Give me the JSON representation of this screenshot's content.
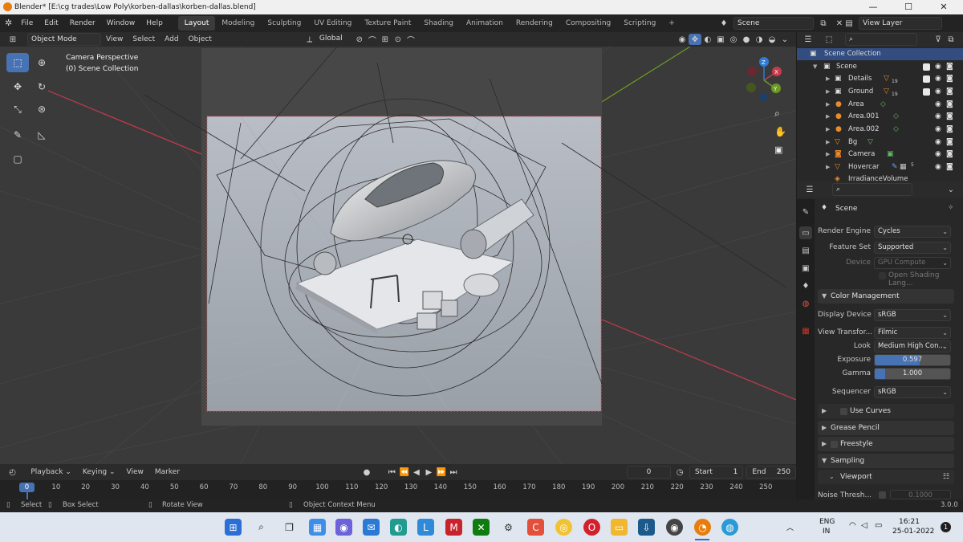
{
  "titlebar": {
    "title": "Blender* [E:\\cg trades\\Low Poly\\korben-dallas\\korben-dallas.blend]",
    "min": "—",
    "max": "☐",
    "close": "✕"
  },
  "menu": {
    "items": [
      "File",
      "Edit",
      "Render",
      "Window",
      "Help"
    ]
  },
  "workspaces": [
    {
      "label": "Layout",
      "active": true
    },
    {
      "label": "Modeling"
    },
    {
      "label": "Sculpting"
    },
    {
      "label": "UV Editing"
    },
    {
      "label": "Texture Paint"
    },
    {
      "label": "Shading"
    },
    {
      "label": "Animation"
    },
    {
      "label": "Rendering"
    },
    {
      "label": "Compositing"
    },
    {
      "label": "Scripting"
    },
    {
      "label": "+"
    }
  ],
  "scene_selector": {
    "value": "Scene"
  },
  "view_layer_selector": {
    "value": "View Layer"
  },
  "viewport_header": {
    "mode": "Object Mode",
    "menus": [
      "View",
      "Select",
      "Add",
      "Object"
    ],
    "transform_orientation": "Global"
  },
  "viewport": {
    "camera_label": "Camera Perspective",
    "collection_label": "(0) Scene Collection",
    "gizmo_axes": {
      "x": "X",
      "y": "Y",
      "z": "Z"
    },
    "colors": {
      "x_axis": "#c43b4d",
      "y_axis": "#6c9a21",
      "z_axis": "#2f7bd6",
      "background": "#3a3a3a"
    }
  },
  "outliner": {
    "rows": [
      {
        "name": "Scene Collection",
        "selected": true,
        "icon": "collection-icon"
      },
      {
        "name": "Scene",
        "icon": "collection-icon",
        "checkbox": true
      },
      {
        "name": "Details",
        "icon": "collection-icon",
        "checkbox": true,
        "badge": "19"
      },
      {
        "name": "Ground",
        "icon": "collection-icon",
        "checkbox": true,
        "badge": "19"
      },
      {
        "name": "Area",
        "icon": "light-icon"
      },
      {
        "name": "Area.001",
        "icon": "light-icon"
      },
      {
        "name": "Area.002",
        "icon": "light-icon"
      },
      {
        "name": "Bg",
        "icon": "mesh-icon"
      },
      {
        "name": "Camera",
        "icon": "camera-icon"
      },
      {
        "name": "Hovercar",
        "icon": "mesh-icon",
        "badge": "5"
      },
      {
        "name": "IrradianceVolume",
        "icon": "probe-icon"
      }
    ]
  },
  "properties": {
    "context": "Scene",
    "render_engine": {
      "label": "Render Engine",
      "value": "Cycles"
    },
    "feature_set": {
      "label": "Feature Set",
      "value": "Supported"
    },
    "device": {
      "label": "Device",
      "value": "GPU Compute"
    },
    "osl": {
      "label": "Open Shading Lang..."
    },
    "color_management": {
      "title": "Color Management",
      "display_device": {
        "label": "Display Device",
        "value": "sRGB"
      },
      "view_transform": {
        "label": "View Transfor...",
        "value": "Filmic"
      },
      "look": {
        "label": "Look",
        "value": "Medium High Con..."
      },
      "exposure": {
        "label": "Exposure",
        "value": "0.597",
        "fraction": 0.597
      },
      "gamma": {
        "label": "Gamma",
        "value": "1.000",
        "fraction": 0.14
      },
      "sequencer": {
        "label": "Sequencer",
        "value": "sRGB"
      },
      "use_curves": "Use Curves"
    },
    "grease_pencil": "Grease Pencil",
    "freestyle": "Freestyle",
    "sampling": "Sampling",
    "viewport_sub": "Viewport",
    "noise_threshold": {
      "label": "Noise Thresh...",
      "value": "0.1000"
    }
  },
  "timeline": {
    "menus": [
      "Playback",
      "Keying",
      "View",
      "Marker"
    ],
    "current_frame": "0",
    "start_label": "Start",
    "start": "1",
    "end_label": "End",
    "end": "250",
    "playhead_frame": "0",
    "ticks": [
      "10",
      "20",
      "30",
      "40",
      "50",
      "60",
      "70",
      "80",
      "90",
      "100",
      "110",
      "120",
      "130",
      "140",
      "150",
      "160",
      "170",
      "180",
      "190",
      "200",
      "210",
      "220",
      "230",
      "240",
      "250"
    ]
  },
  "statusbar": {
    "select": "Select",
    "box_select": "Box Select",
    "rotate_view": "Rotate View",
    "context_menu": "Object Context Menu",
    "version": "3.0.0"
  },
  "taskbar": {
    "lang1": "ENG",
    "lang2": "IN",
    "time": "16:21",
    "date": "25-01-2022",
    "notifications": "1"
  }
}
